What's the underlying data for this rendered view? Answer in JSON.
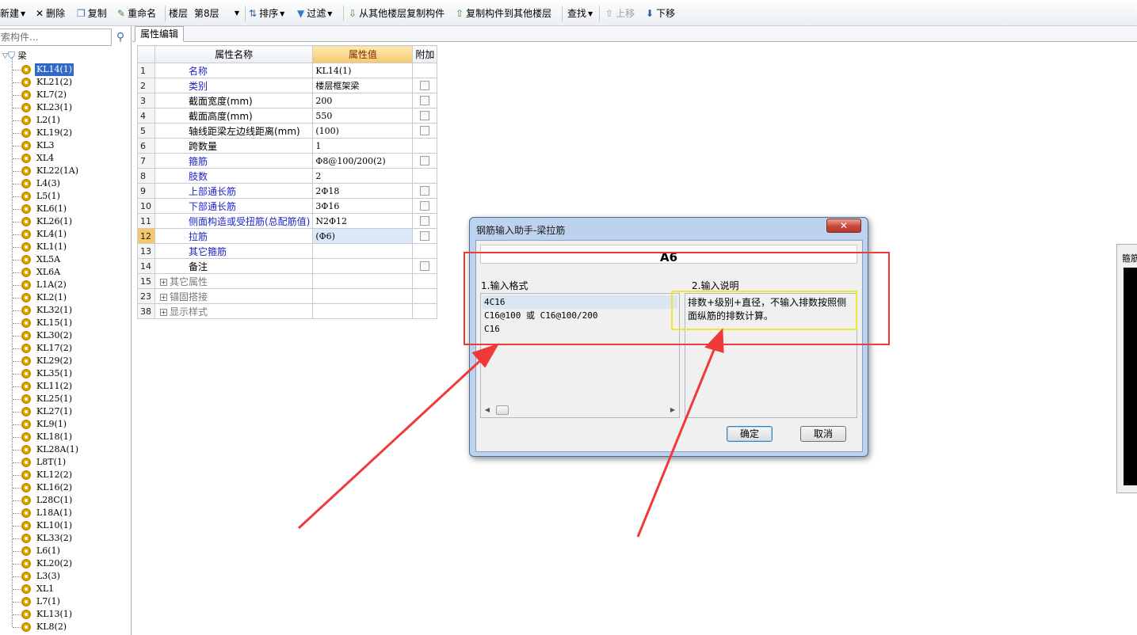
{
  "toolbar": {
    "new": "新建",
    "delete": "删除",
    "copy": "复制",
    "rename": "重命名",
    "floor_label": "楼层",
    "floor_value": "第8层",
    "sort": "排序",
    "filter": "过滤",
    "copy_from": "从其他楼层复制构件",
    "copy_to": "复制构件到其他楼层",
    "find": "查找",
    "move_up": "上移",
    "move_down": "下移"
  },
  "left": {
    "search_placeholder": "索构件...",
    "root": "梁",
    "items": [
      "KL14(1)",
      "KL21(2)",
      "KL7(2)",
      "KL23(1)",
      "L2(1)",
      "KL19(2)",
      "KL3",
      "XL4",
      "KL22(1A)",
      "L4(3)",
      "L5(1)",
      "KL6(1)",
      "KL26(1)",
      "KL4(1)",
      "KL1(1)",
      "XL5A",
      "XL6A",
      "L1A(2)",
      "KL2(1)",
      "KL32(1)",
      "KL15(1)",
      "KL30(2)",
      "KL17(2)",
      "KL29(2)",
      "KL35(1)",
      "KL11(2)",
      "KL25(1)",
      "KL27(1)",
      "KL9(1)",
      "KL18(1)",
      "KL28A(1)",
      "L8T(1)",
      "KL12(2)",
      "KL16(2)",
      "L28C(1)",
      "L18A(1)",
      "KL10(1)",
      "KL33(2)",
      "L6(1)",
      "KL20(2)",
      "L3(3)",
      "XL1",
      "L7(1)",
      "KL13(1)",
      "KL8(2)"
    ]
  },
  "tab": "属性编辑",
  "grid": {
    "headers": {
      "name": "属性名称",
      "value": "属性值",
      "extra": "附加"
    },
    "rows": [
      {
        "num": "1",
        "name": "名称",
        "value": "KL14(1)"
      },
      {
        "num": "2",
        "name": "类别",
        "value": "楼层框架梁"
      },
      {
        "num": "3",
        "name": "截面宽度(mm)",
        "value": "200"
      },
      {
        "num": "4",
        "name": "截面高度(mm)",
        "value": "550"
      },
      {
        "num": "5",
        "name": "轴线距梁左边线距离(mm)",
        "value": "(100)"
      },
      {
        "num": "6",
        "name": "跨数量",
        "value": "1"
      },
      {
        "num": "7",
        "name": "箍筋",
        "value": "Φ8@100/200(2)"
      },
      {
        "num": "8",
        "name": "肢数",
        "value": "2"
      },
      {
        "num": "9",
        "name": "上部通长筋",
        "value": "2Φ18"
      },
      {
        "num": "10",
        "name": "下部通长筋",
        "value": "3Φ16"
      },
      {
        "num": "11",
        "name": "侧面构造或受扭筋(总配筋值)",
        "value": "N2Φ12"
      },
      {
        "num": "12",
        "name": "拉筋",
        "value": "(Φ6)"
      },
      {
        "num": "13",
        "name": "其它箍筋",
        "value": ""
      },
      {
        "num": "14",
        "name": "备注",
        "value": ""
      },
      {
        "num": "15",
        "name": "其它属性",
        "value": ""
      },
      {
        "num": "23",
        "name": "锚固搭接",
        "value": ""
      },
      {
        "num": "38",
        "name": "显示样式",
        "value": ""
      }
    ]
  },
  "dialog": {
    "title": "钢筋输入助手-梁拉筋",
    "input_value": "A6",
    "format_label": "1.输入格式",
    "desc_label": "2.输入说明",
    "formats": [
      "4C16",
      "C16@100 或 C16@100/200",
      "C16"
    ],
    "description": "排数+级别+直径，不输入排数按照侧面纵筋的排数计算。",
    "ok": "确定",
    "cancel": "取消"
  },
  "right_panel": {
    "label": "箍筋"
  },
  "colors": {
    "annotation_red": "#f03a3a",
    "annotation_yellow": "#f2e82a",
    "selection": "#316ac5",
    "header_value": "#f7c86b"
  }
}
